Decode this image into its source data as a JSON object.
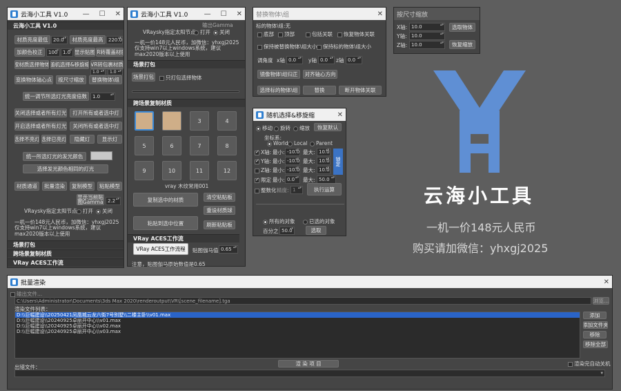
{
  "win1": {
    "title": "云海小工具 V1.0",
    "header": "云海小工具 V1.0",
    "lum_min_label": "材质亮度最低",
    "lum_min_val": "20.0",
    "lum_max_label": "材质亮度最高",
    "lum_max_val": "220.0",
    "color_range_label": "加颜色校正",
    "color_range_a": "100",
    "color_range_b": "1.0",
    "show_map_btn": "显示贴图",
    "vr_reflect_btn": "VR转覆盖材质",
    "sel_by_mat_btn": "按材质选择物体",
    "random_sel_btn": "随机选择&移旋缩",
    "vr_to_standard_btn": "VR转包裹材质",
    "vr_val_a": "1.0",
    "vr_val_b": "1.0",
    "axis_btn": "变换物体轴心点",
    "scale_btn": "按尺寸缩放",
    "replace_btn": "替换物体\\组",
    "uniform_label": "统一调节所选灯光亮度倍数",
    "uniform_val": "1.0",
    "close_lights_btn": "关闭选择或者所有灯光",
    "open_lights_btn": "打开所有或者选中灯",
    "open_sel_lights_btn": "开启选择或者所有灯光",
    "close_all_btn": "关闭所有或者选中灯",
    "sel_off_btn": "选择不亮灯",
    "sel_on_btn": "选择已亮灯",
    "hide_btn": "隐藏灯",
    "show_btn": "显示灯",
    "unify_emit_btn": "统一所选灯光的发光颜色",
    "sel_same_color_btn": "选择发光颜色相同的灯光",
    "mat_channel_btn": "材质通道",
    "batch_render_btn": "批量渲染",
    "copy_model_btn": "复制模型",
    "paste_model_btn": "粘贴模型",
    "show_current_btn": "显示当前贴图Gamma",
    "gamma_val": "2.2",
    "sky_label": "VRaysky指定太阳节点",
    "on": "打开",
    "off": "关闭",
    "promo": "一机一价148元人民币，加微信：yhxgj2025",
    "compat": "仅支持win7以上windows系统，建议max2020版本以上使用",
    "sec_scene": "场景打包",
    "sec_cross": "跨场景复制材质",
    "sec_vray": "VRay ACES工作流"
  },
  "win2": {
    "title": "云海小工具 V1.0",
    "gamma_label": "输出Gamma",
    "sky_label": "VRaysky指定太阳节点",
    "on": "打开",
    "off": "关闭",
    "promo": "一机一价148元人民币，加微信：yhxgj2025",
    "compat": "仅支持win7以上windows系统，建议max2020版本以上使用",
    "sec_scene": "场景打包",
    "scene_pack_btn": "场景打包",
    "only_pack_label": "只打包选择物体",
    "sec_cross": "跨场景复制材质",
    "slots": [
      "",
      "",
      "3",
      "4",
      "5",
      "6",
      "7",
      "8",
      "9",
      "10",
      "11",
      "12"
    ],
    "mat_name": "vray 木纹常用001",
    "copy_sel_mat_btn": "复制选中的材质",
    "clear_clip_btn": "清空粘贴板",
    "reset_mat_btn": "重设材质球",
    "paste_to_sel_btn": "粘贴到选中位置",
    "refresh_clip_btn": "刷新粘贴板",
    "sec_vray": "VRay ACES工作流",
    "aces_btn": "VRay ACES工作流程",
    "map_gamma_label": "贴图伽马值",
    "map_gamma_val": "0.65",
    "note": "注意，贴图伽马原始数值是0.65"
  },
  "win3": {
    "title": "替换物体\\组",
    "target_label": "标的物体\\组:无",
    "base": "底部",
    "top": "顶部",
    "include_assoc": "包括关联",
    "restore_assoc": "恢复物体关联",
    "keep_replace_size": "保持被替换物体\\组大小",
    "keep_target_size": "保持标的物体\\组大小",
    "angle_label": "调角度",
    "x_label": "x轴",
    "y_label": "y轴",
    "z_label": "z轴",
    "x_val": "0.0",
    "y_val": "0.0",
    "z_val": "0.0",
    "mirror_btn": "镜像物体\\组归正",
    "align_btn": "对齐轴心方向",
    "pick_btn": "选择标的物体\\组",
    "replace_btn": "替换",
    "break_btn": "断开物体关联"
  },
  "win4": {
    "title": "按尺寸缩放",
    "x_label": "X轴:",
    "y_label": "Y轴:",
    "z_label": "Z轴:",
    "x_val": "10.0",
    "y_val": "10.0",
    "z_val": "10.0",
    "pick_btn": "选取物体",
    "restore_btn": "恢复缩放"
  },
  "win5": {
    "title": "随机选择&移旋缩",
    "move": "移动",
    "rotate": "旋转",
    "scale": "缩放",
    "restore_btn": "恢复默认",
    "coord_label": "坐标系:",
    "world": "World",
    "local": "Local",
    "parent": "Parent",
    "x_axis": "X轴:",
    "y_axis": "Y轴:",
    "z_axis": "Z轴:",
    "min_label": "最小:",
    "max_label": "最大:",
    "x_min": "-10.0",
    "x_max": "10.0",
    "y_min": "-10.0",
    "y_max": "10.0",
    "z_min": "-10.0",
    "z_max": "10.0",
    "lock_label": "锁定",
    "limit_label": "限定",
    "limit_min": "0.0",
    "limit_max": "50.0",
    "integer_label": "整数化",
    "precision_label": "精度:",
    "precision_val": "1",
    "exec_btn": "执行运算",
    "all_objects": "所有的对象",
    "selected_objects": "已选的对象",
    "percent_label": "百分之",
    "percent_val": "50.0",
    "pick_btn": "选取"
  },
  "logo": {
    "name": "云海小工具",
    "price": "一机一价148元人民币",
    "wechat": "购买请加微信：yhxgj2025",
    "accent": "#5f8fd4"
  },
  "batch": {
    "title": "批量渲染",
    "output_label": "输出文件...",
    "output_path": "C:\\Users\\Administrator\\Documents\\3ds Max 2020\\renderoutput\\VR\\[scene_filename].tga",
    "browse_btn": "浏览...",
    "list_label": "渲染文件列表：",
    "files": [
      "D:\\\\巨幅建设\\\\20250421凤凰城云龙六街7号别墅\\\\二楼主卧\\\\v01.max",
      "D:\\\\巨幅建设\\\\20240925卓丽开中心\\\\v01.max",
      "D:\\\\巨幅建设\\\\20240925卓丽开中心\\\\v02.max",
      "D:\\\\巨幅建设\\\\20240925卓丽开中心\\\\v03.max"
    ],
    "add_btn": "添加",
    "add_folder_btn": "添加文件夹",
    "remove_btn": "移除",
    "remove_all_btn": "移除全部",
    "render_btn": "渲 染 项 目",
    "auto_shutdown": "渲染完自动关机",
    "error_label": "出错文件："
  }
}
